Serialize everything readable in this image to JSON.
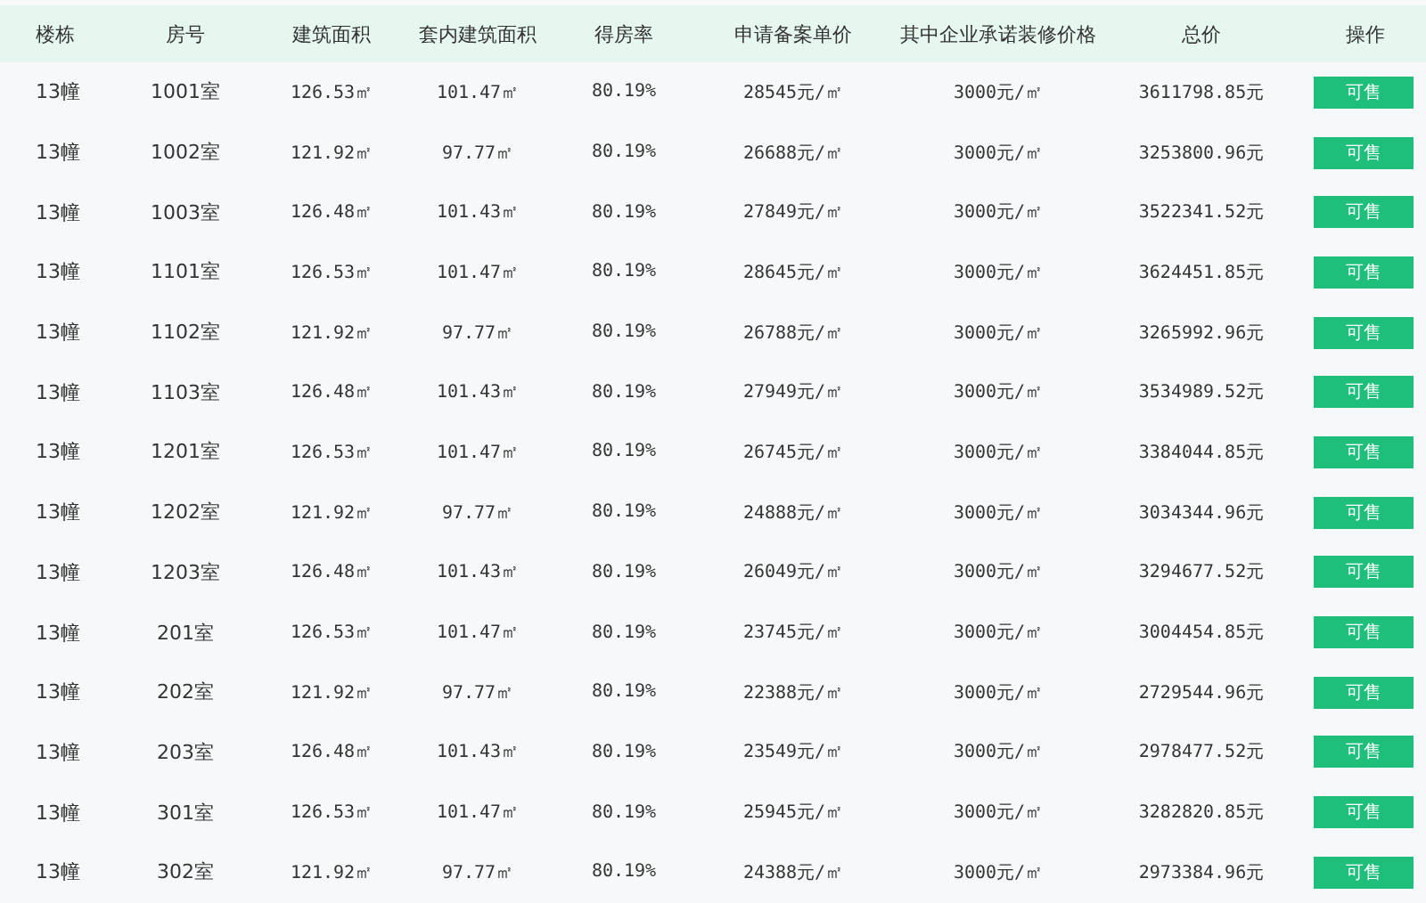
{
  "columns": [
    "楼栋",
    "房号",
    "建筑面积",
    "套内建筑面积",
    "得房率",
    "申请备案单价",
    "其中企业承诺装修价格",
    "总价",
    "操作"
  ],
  "rows": [
    {
      "cells": [
        "13幢",
        "1001室",
        "126.53㎡",
        "101.47㎡",
        "80.19%",
        "28545元/㎡",
        "3000元/㎡",
        "3611798.85元"
      ],
      "action": "可售"
    },
    {
      "cells": [
        "13幢",
        "1002室",
        "121.92㎡",
        "97.77㎡",
        "80.19%",
        "26688元/㎡",
        "3000元/㎡",
        "3253800.96元"
      ],
      "action": "可售"
    },
    {
      "cells": [
        "13幢",
        "1003室",
        "126.48㎡",
        "101.43㎡",
        "80.19%",
        "27849元/㎡",
        "3000元/㎡",
        "3522341.52元"
      ],
      "action": "可售"
    },
    {
      "cells": [
        "13幢",
        "1101室",
        "126.53㎡",
        "101.47㎡",
        "80.19%",
        "28645元/㎡",
        "3000元/㎡",
        "3624451.85元"
      ],
      "action": "可售"
    },
    {
      "cells": [
        "13幢",
        "1102室",
        "121.92㎡",
        "97.77㎡",
        "80.19%",
        "26788元/㎡",
        "3000元/㎡",
        "3265992.96元"
      ],
      "action": "可售"
    },
    {
      "cells": [
        "13幢",
        "1103室",
        "126.48㎡",
        "101.43㎡",
        "80.19%",
        "27949元/㎡",
        "3000元/㎡",
        "3534989.52元"
      ],
      "action": "可售"
    },
    {
      "cells": [
        "13幢",
        "1201室",
        "126.53㎡",
        "101.47㎡",
        "80.19%",
        "26745元/㎡",
        "3000元/㎡",
        "3384044.85元"
      ],
      "action": "可售"
    },
    {
      "cells": [
        "13幢",
        "1202室",
        "121.92㎡",
        "97.77㎡",
        "80.19%",
        "24888元/㎡",
        "3000元/㎡",
        "3034344.96元"
      ],
      "action": "可售"
    },
    {
      "cells": [
        "13幢",
        "1203室",
        "126.48㎡",
        "101.43㎡",
        "80.19%",
        "26049元/㎡",
        "3000元/㎡",
        "3294677.52元"
      ],
      "action": "可售"
    },
    {
      "cells": [
        "13幢",
        "201室",
        "126.53㎡",
        "101.47㎡",
        "80.19%",
        "23745元/㎡",
        "3000元/㎡",
        "3004454.85元"
      ],
      "action": "可售"
    },
    {
      "cells": [
        "13幢",
        "202室",
        "121.92㎡",
        "97.77㎡",
        "80.19%",
        "22388元/㎡",
        "3000元/㎡",
        "2729544.96元"
      ],
      "action": "可售"
    },
    {
      "cells": [
        "13幢",
        "203室",
        "126.48㎡",
        "101.43㎡",
        "80.19%",
        "23549元/㎡",
        "3000元/㎡",
        "2978477.52元"
      ],
      "action": "可售"
    },
    {
      "cells": [
        "13幢",
        "301室",
        "126.53㎡",
        "101.47㎡",
        "80.19%",
        "25945元/㎡",
        "3000元/㎡",
        "3282820.85元"
      ],
      "action": "可售"
    },
    {
      "cells": [
        "13幢",
        "302室",
        "121.92㎡",
        "97.77㎡",
        "80.19%",
        "24388元/㎡",
        "3000元/㎡",
        "2973384.96元"
      ],
      "action": "可售"
    }
  ]
}
